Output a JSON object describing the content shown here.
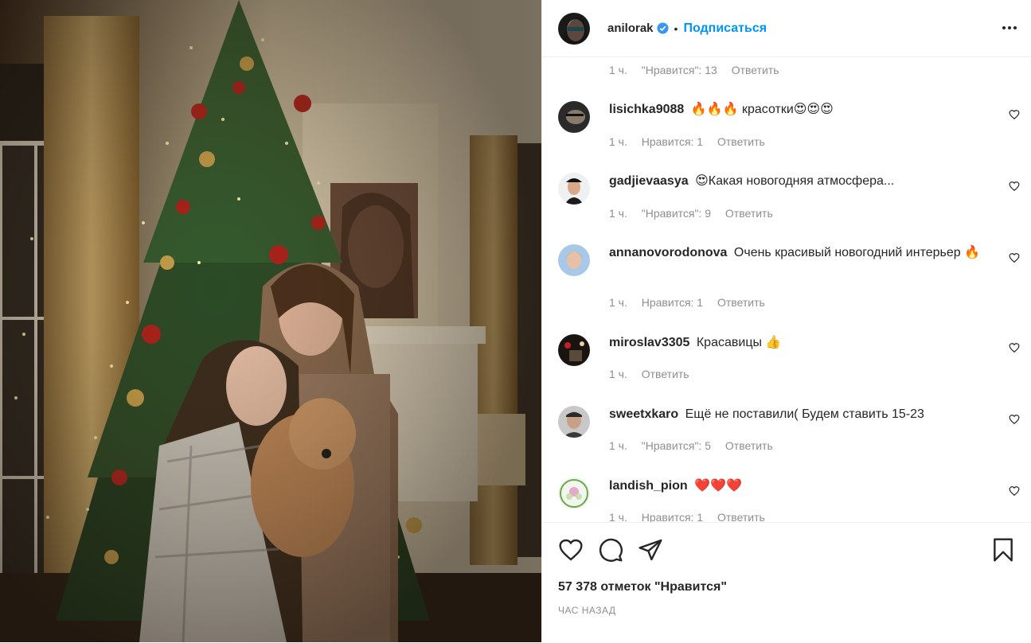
{
  "post": {
    "author": "anilorak",
    "follow_label": "Подписаться",
    "more_icon": "more-options-icon"
  },
  "comments": {
    "top_meta": {
      "time": "1 ч.",
      "likes": "\"Нравится\": 13",
      "reply": "Ответить"
    },
    "items": [
      {
        "user": "lisichka9088",
        "text": "🔥🔥🔥 красотки😍😍😍",
        "time": "1 ч.",
        "likes": "Нравится: 1",
        "reply": "Ответить"
      },
      {
        "user": "gadjievaasya",
        "text": "😍Какая новогодняя атмосфера...",
        "time": "1 ч.",
        "likes": "\"Нравится\": 9",
        "reply": "Ответить"
      },
      {
        "user": "annanovorodonova",
        "text": "Очень красивый новогодний интерьер 🔥",
        "time": "1 ч.",
        "likes": "Нравится: 1",
        "reply": "Ответить"
      },
      {
        "user": "miroslav3305",
        "text": "Красавицы 👍",
        "time": "1 ч.",
        "likes": "",
        "reply": "Ответить"
      },
      {
        "user": "sweetxkaro",
        "text": "Ещё не поставили( Будем ставить 15-23",
        "time": "1 ч.",
        "likes": "\"Нравится\": 5",
        "reply": "Ответить"
      },
      {
        "user": "landish_pion",
        "text": "❤️❤️❤️",
        "time": "1 ч.",
        "likes": "Нравится: 1",
        "reply": "Ответить"
      }
    ]
  },
  "footer": {
    "likes": "57 378 отметок \"Нравится\"",
    "time": "ЧАС НАЗАД"
  },
  "colors": {
    "link": "#0095f6",
    "muted": "#8e8e8e",
    "text": "#262626",
    "border": "#efefef"
  }
}
